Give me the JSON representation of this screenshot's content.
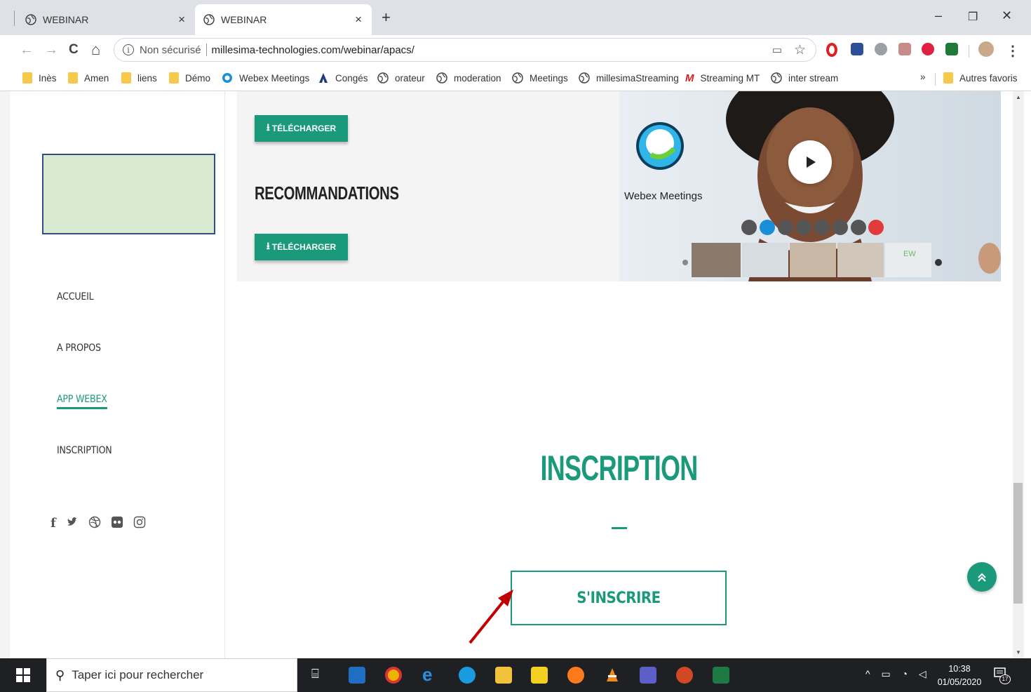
{
  "browser": {
    "tabs": [
      {
        "title": "WEBINAR",
        "close": "×"
      },
      {
        "title": "WEBINAR",
        "close": "×"
      }
    ],
    "new_tab": "+",
    "window_controls": {
      "minimize": "–",
      "restore": "❐",
      "close": "✕"
    },
    "nav": {
      "back": "←",
      "forward": "→",
      "reload": "C",
      "home": "⌂"
    },
    "address": {
      "security": "Non sécurisé",
      "url": "millesima-technologies.com/webinar/apacs/"
    },
    "bookmarks": [
      {
        "label": "Inès",
        "icon": "folder-icon"
      },
      {
        "label": "Amen",
        "icon": "folder-icon"
      },
      {
        "label": "liens",
        "icon": "folder-icon"
      },
      {
        "label": "Démo",
        "icon": "folder-icon"
      },
      {
        "label": "Webex Meetings",
        "icon": "webex-icon"
      },
      {
        "label": "Congés",
        "icon": "congés-icon"
      },
      {
        "label": "orateur",
        "icon": "globe-icon"
      },
      {
        "label": "moderation",
        "icon": "globe-icon"
      },
      {
        "label": "Meetings",
        "icon": "globe-icon"
      },
      {
        "label": "millesimaStreaming",
        "icon": "globe-icon"
      },
      {
        "label": "Streaming MT",
        "icon": "streaming-icon"
      },
      {
        "label": "inter stream",
        "icon": "globe-icon"
      }
    ],
    "bookmarks_more": "»",
    "other_bookmarks": "Autres favoris"
  },
  "sidebar": {
    "nav": [
      {
        "label": "ACCUEIL",
        "active": false
      },
      {
        "label": "A PROPOS",
        "active": false
      },
      {
        "label": "APP WEBEX",
        "active": true
      },
      {
        "label": "INSCRIPTION",
        "active": false
      }
    ],
    "socials": [
      "facebook-icon",
      "twitter-icon",
      "dribbble-icon",
      "flickr-icon",
      "instagram-icon"
    ]
  },
  "main": {
    "download_label": "TÉLÉCHARGER",
    "recommendations_title": "RECOMMANDATIONS",
    "video": {
      "brand": "Webex Meetings",
      "participant_initials": "EW"
    },
    "inscription_title": "INSCRIPTION",
    "register_button": "S'INSCRIRE"
  },
  "taskbar": {
    "search_placeholder": "Taper ici pour rechercher",
    "time": "10:38",
    "date": "01/05/2020",
    "notifications": "17"
  },
  "colors": {
    "accent": "#1a9a7a",
    "logo_box_fill": "#d9ead3",
    "logo_box_border": "#2d4f86"
  }
}
